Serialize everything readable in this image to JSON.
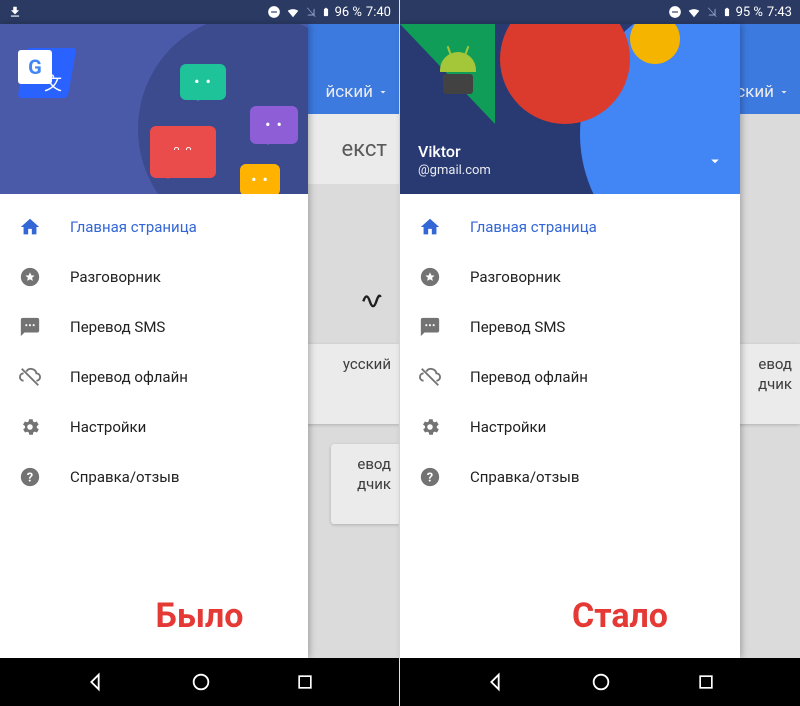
{
  "left": {
    "status": {
      "battery": "96 %",
      "time": "7:40"
    },
    "behind": {
      "language_label": "йский",
      "text_label": "екст",
      "card1": "усский",
      "card2_line1": "евод",
      "card2_line2": "дчик"
    },
    "nav": {
      "items": [
        {
          "icon": "home",
          "label": "Главная страница",
          "active": true
        },
        {
          "icon": "star",
          "label": "Разговорник",
          "active": false
        },
        {
          "icon": "sms",
          "label": "Перевод SMS",
          "active": false
        },
        {
          "icon": "cloud-off",
          "label": "Перевод офлайн",
          "active": false
        },
        {
          "icon": "settings",
          "label": "Настройки",
          "active": false
        },
        {
          "icon": "help",
          "label": "Справка/отзыв",
          "active": false
        }
      ]
    },
    "caption": "Было"
  },
  "right": {
    "status": {
      "battery": "95 %",
      "time": "7:43"
    },
    "behind": {
      "language_label": "йский",
      "card1_line1": "евод",
      "card1_line2": "дчик"
    },
    "header": {
      "user_name": "Viktor",
      "user_email": "@gmail.com"
    },
    "nav": {
      "items": [
        {
          "icon": "home",
          "label": "Главная страница",
          "active": true
        },
        {
          "icon": "star",
          "label": "Разговорник",
          "active": false
        },
        {
          "icon": "sms",
          "label": "Перевод SMS",
          "active": false
        },
        {
          "icon": "cloud-off",
          "label": "Перевод офлайн",
          "active": false
        },
        {
          "icon": "settings",
          "label": "Настройки",
          "active": false
        },
        {
          "icon": "help",
          "label": "Справка/отзыв",
          "active": false
        }
      ]
    },
    "caption": "Стало"
  },
  "icons": {
    "home": "home-icon",
    "star": "star-icon",
    "sms": "sms-icon",
    "cloud-off": "cloud-off-icon",
    "settings": "gear-icon",
    "help": "help-icon"
  },
  "colors": {
    "accent": "#3367d6",
    "caption": "#e53935"
  }
}
